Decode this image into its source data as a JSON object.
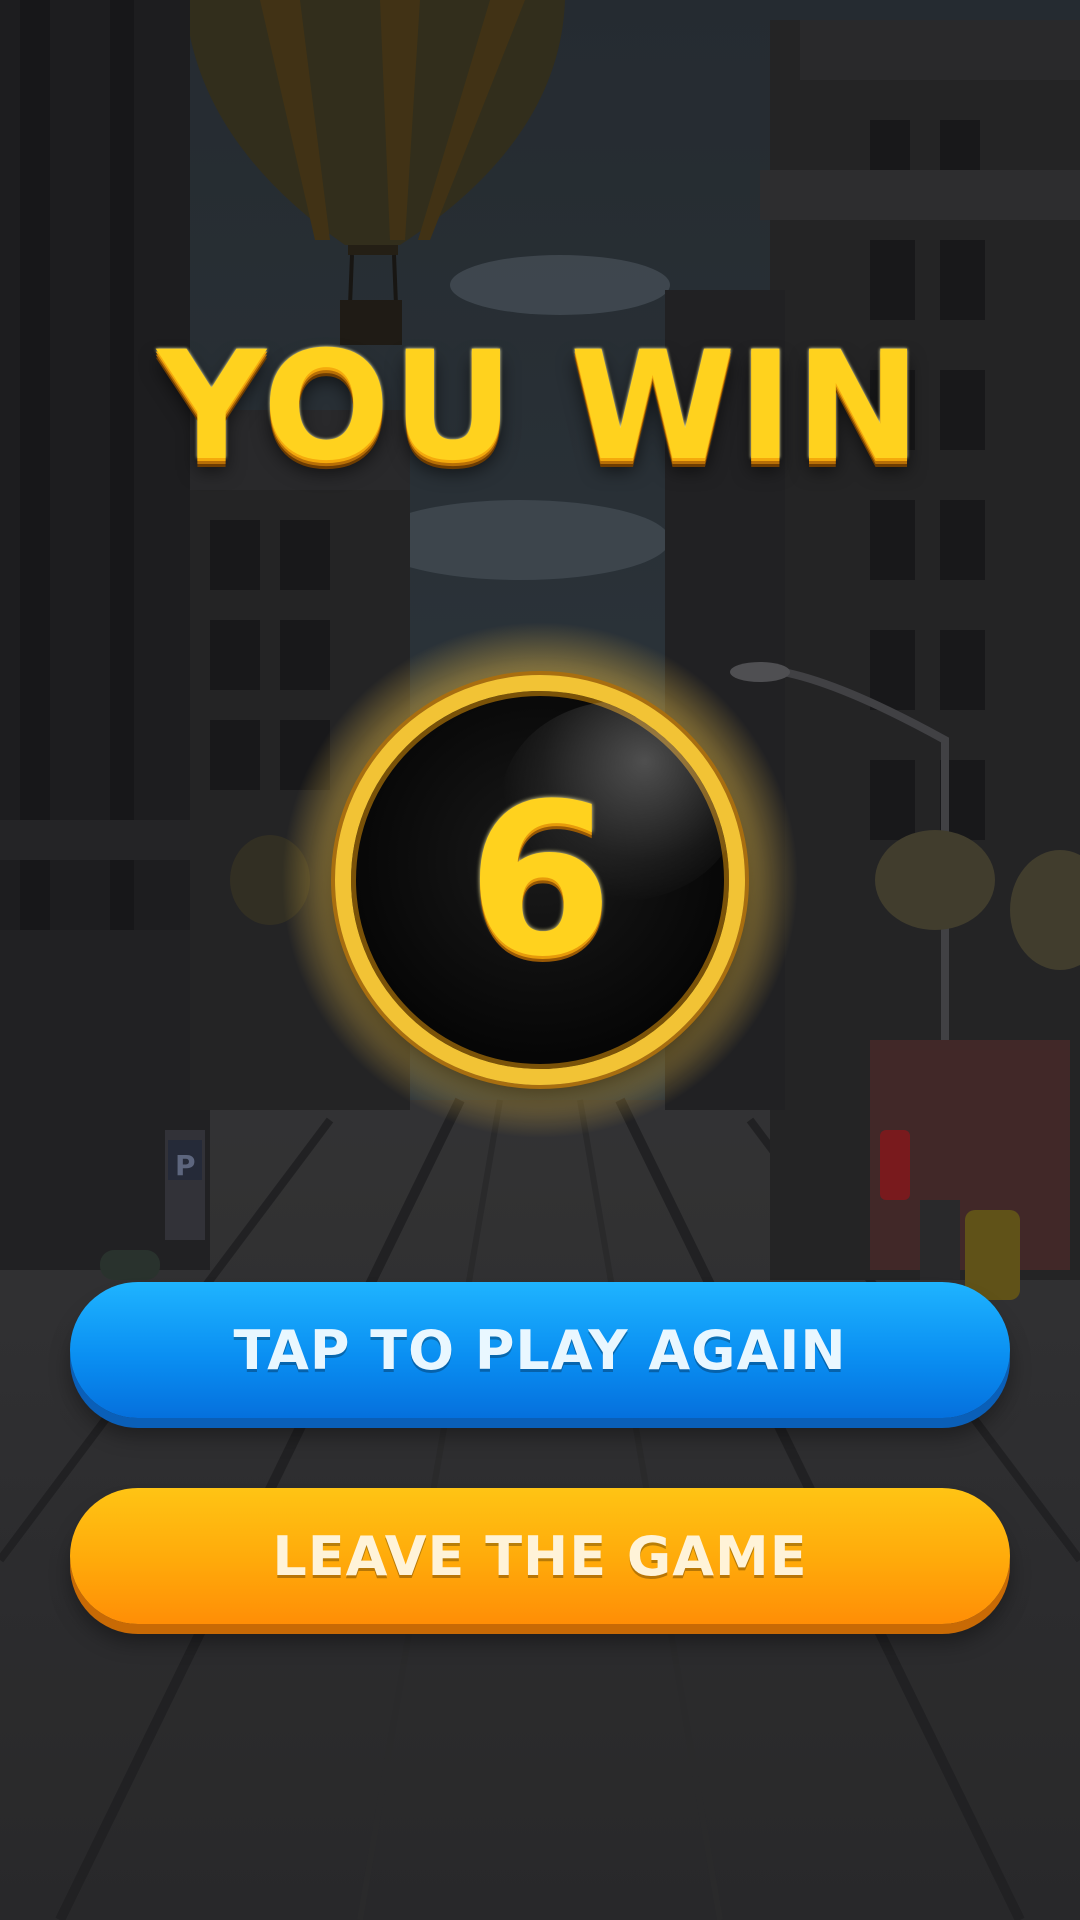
{
  "result": {
    "title": "YOU WIN",
    "score": "6"
  },
  "buttons": {
    "play_again": "TAP TO PLAY AGAIN",
    "leave": "LEAVE THE GAME"
  },
  "background": {
    "parking_sign": "P"
  },
  "colors": {
    "title_gold": "#ffd21e",
    "play_button": "#0a8ff2",
    "leave_button": "#ffa90a"
  }
}
